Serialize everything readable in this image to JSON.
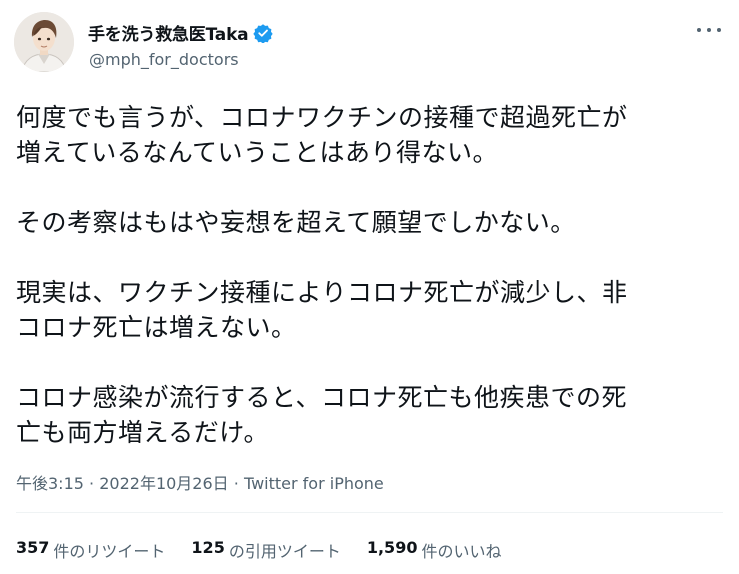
{
  "author": {
    "display_name": "手を洗う救急医Taka",
    "handle": "@mph_for_doctors",
    "verified_color": "#1d9bf0"
  },
  "icons": [
    "verified-badge-icon",
    "more-options-icon"
  ],
  "tweet": {
    "paragraphs": [
      "何度でも言うが、コロナワクチンの接種で超過死亡が\n増えているなんていうことはあり得ない。",
      "その考察はもはや妄想を超えて願望でしかない。",
      "現実は、ワクチン接種によりコロナ死亡が減少し、非\nコロナ死亡は増えない。",
      "コロナ感染が流行すると、コロナ死亡も他疾患での死\n亡も両方増えるだけ。"
    ],
    "time": "午後3:15",
    "separator": "·",
    "date": "2022年10月26日",
    "source": "Twitter for iPhone"
  },
  "stats": {
    "retweets": {
      "count": "357",
      "label": "件のリツイート"
    },
    "quotes": {
      "count": "125",
      "label": "の引用ツイート"
    },
    "likes": {
      "count": "1,590",
      "label": "件のいいね"
    }
  }
}
